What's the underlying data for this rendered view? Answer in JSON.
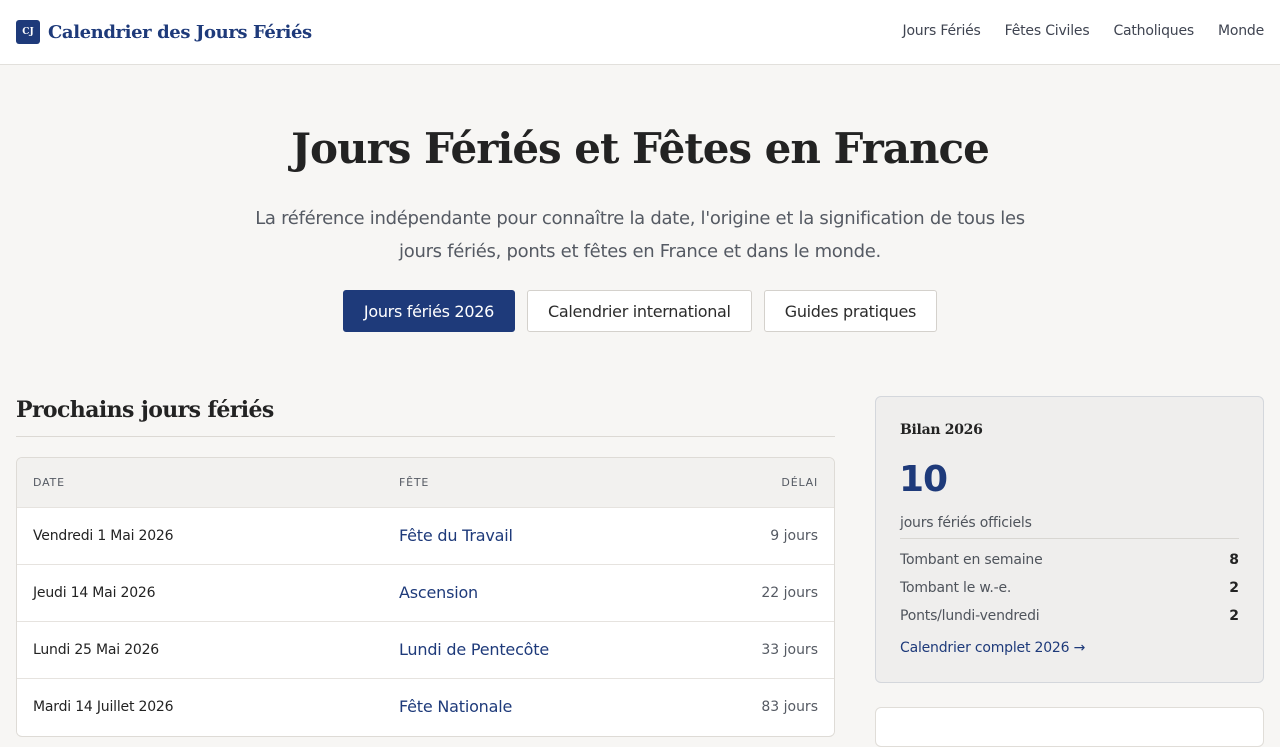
{
  "header": {
    "logo_text": "CJ",
    "site_title": "Calendrier des Jours Fériés",
    "nav": [
      "Jours Fériés",
      "Fêtes Civiles",
      "Catholiques",
      "Monde"
    ]
  },
  "hero": {
    "title": "Jours Fériés et Fêtes en France",
    "subtitle": "La référence indépendante pour connaître la date, l'origine et la signification de tous les jours fériés, ponts et fêtes en France et dans le monde.",
    "buttons": [
      "Jours fériés 2026",
      "Calendrier international",
      "Guides pratiques"
    ]
  },
  "upcoming": {
    "title": "Prochains jours fériés",
    "columns": {
      "date": "DATE",
      "fete": "FÊTE",
      "delai": "DÉLAI"
    },
    "rows": [
      {
        "date": "Vendredi 1 Mai 2026",
        "fete": "Fête du Travail",
        "delai": "9 jours"
      },
      {
        "date": "Jeudi 14 Mai 2026",
        "fete": "Ascension",
        "delai": "22 jours"
      },
      {
        "date": "Lundi 25 Mai 2026",
        "fete": "Lundi de Pentecôte",
        "delai": "33 jours"
      },
      {
        "date": "Mardi 14 Juillet 2026",
        "fete": "Fête Nationale",
        "delai": "83 jours"
      }
    ]
  },
  "summary": {
    "title": "Bilan 2026",
    "count": "10",
    "caption": "jours fériés officiels",
    "stats": [
      {
        "label": "Tombant en semaine",
        "value": "8"
      },
      {
        "label": "Tombant le w.-e.",
        "value": "2"
      },
      {
        "label": "Ponts/lundi-vendredi",
        "value": "2"
      }
    ],
    "link": "Calendrier complet 2026 →"
  },
  "colors": {
    "brand": "#1e3a7a",
    "background": "#f7f6f4"
  }
}
